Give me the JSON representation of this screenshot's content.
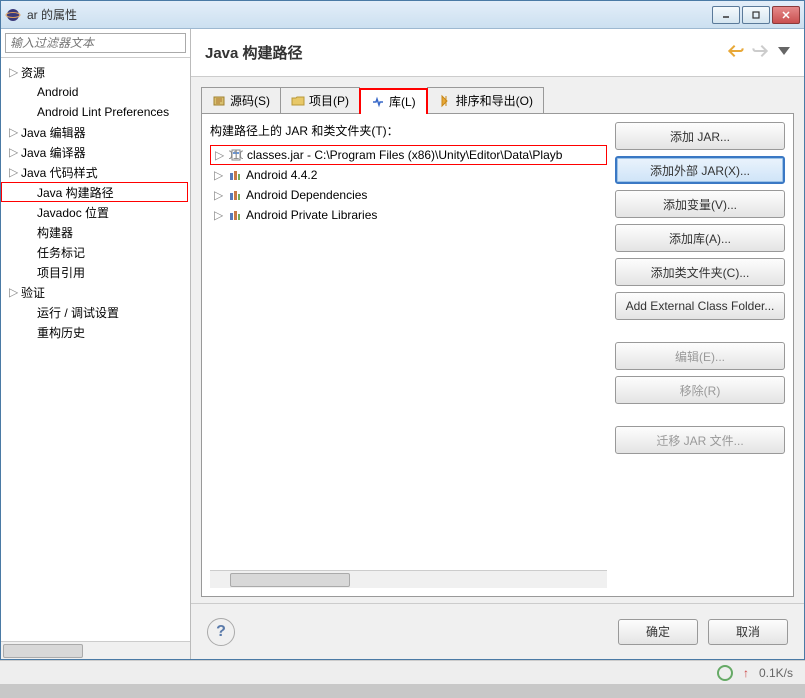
{
  "window": {
    "title": "ar 的属性"
  },
  "filter": {
    "placeholder": "输入过滤器文本"
  },
  "tree": [
    {
      "label": "资源",
      "expand": true,
      "level": 0
    },
    {
      "label": "Android",
      "level": 1
    },
    {
      "label": "Android Lint Preferences",
      "level": 1
    },
    {
      "label": "Java 编辑器",
      "expand": true,
      "level": 0
    },
    {
      "label": "Java 编译器",
      "expand": true,
      "level": 0
    },
    {
      "label": "Java 代码样式",
      "expand": true,
      "level": 0
    },
    {
      "label": "Java 构建路径",
      "level": 1,
      "highlight": true
    },
    {
      "label": "Javadoc 位置",
      "level": 1
    },
    {
      "label": "构建器",
      "level": 1
    },
    {
      "label": "任务标记",
      "level": 1
    },
    {
      "label": "项目引用",
      "level": 1
    },
    {
      "label": "验证",
      "expand": true,
      "level": 0
    },
    {
      "label": "运行 / 调试设置",
      "level": 1
    },
    {
      "label": "重构历史",
      "level": 1
    }
  ],
  "main": {
    "title": "Java 构建路径"
  },
  "tabs": [
    {
      "label": "源码(S)"
    },
    {
      "label": "项目(P)"
    },
    {
      "label": "库(L)",
      "active": true,
      "highlight": true
    },
    {
      "label": "排序和导出(O)"
    }
  ],
  "tabcontent": {
    "label": "构建路径上的 JAR 和类文件夹(T)：",
    "items": [
      {
        "label": "classes.jar  -  C:\\Program Files (x86)\\Unity\\Editor\\Data\\Playb",
        "icon": "jar",
        "hl": true
      },
      {
        "label": "Android 4.4.2",
        "icon": "lib"
      },
      {
        "label": "Android Dependencies",
        "icon": "lib"
      },
      {
        "label": "Android Private Libraries",
        "icon": "lib"
      }
    ]
  },
  "buttons": [
    {
      "label": "添加 JAR..."
    },
    {
      "label": "添加外部 JAR(X)...",
      "highlight": true
    },
    {
      "label": "添加变量(V)..."
    },
    {
      "label": "添加库(A)..."
    },
    {
      "label": "添加类文件夹(C)..."
    },
    {
      "label": "Add External Class Folder..."
    },
    {
      "label": "编辑(E)...",
      "disabled": true
    },
    {
      "label": "移除(R)",
      "disabled": true
    },
    {
      "label": "迁移 JAR 文件...",
      "disabled": true
    }
  ],
  "footer": {
    "ok": "确定",
    "cancel": "取消"
  },
  "status": {
    "speed": "0.1K/s"
  }
}
